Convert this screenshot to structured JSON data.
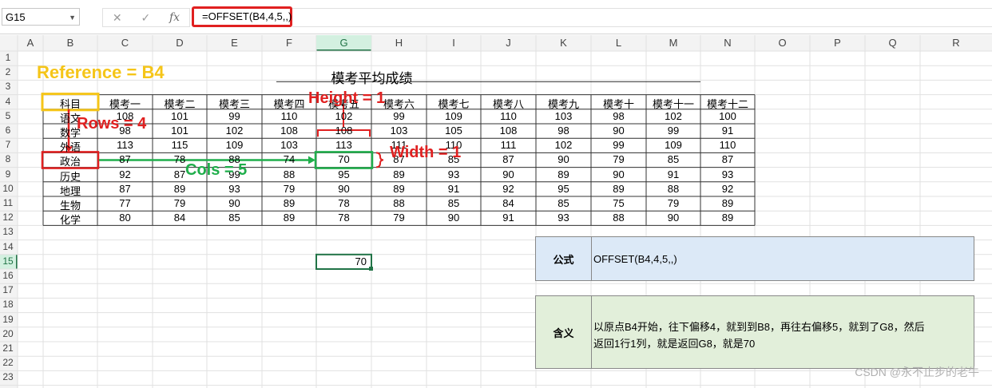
{
  "formula_bar": {
    "name_box": "G15",
    "cancel_symbol": "✕",
    "confirm_symbol": "✓",
    "fx_symbol": "fx",
    "formula": "=OFFSET(B4,4,5,,)"
  },
  "columns": [
    "A",
    "B",
    "C",
    "D",
    "E",
    "F",
    "G",
    "H",
    "I",
    "J",
    "K",
    "L",
    "M",
    "N",
    "O",
    "P",
    "Q",
    "R"
  ],
  "rows": [
    "1",
    "2",
    "3",
    "4",
    "5",
    "6",
    "7",
    "8",
    "9",
    "10",
    "11",
    "12",
    "13",
    "14",
    "15",
    "16",
    "17",
    "18",
    "19",
    "20",
    "21",
    "22",
    "23"
  ],
  "table": {
    "title": "模考平均成绩",
    "header": [
      "科目",
      "模考一",
      "模考二",
      "模考三",
      "模考四",
      "模考五",
      "模考六",
      "模考七",
      "模考八",
      "模考九",
      "模考十",
      "模考十一",
      "模考十二"
    ],
    "rows": [
      [
        "语文",
        "108",
        "101",
        "99",
        "110",
        "102",
        "99",
        "109",
        "110",
        "103",
        "98",
        "102",
        "100"
      ],
      [
        "数学",
        "98",
        "101",
        "102",
        "108",
        "108",
        "103",
        "105",
        "108",
        "98",
        "90",
        "99",
        "91"
      ],
      [
        "外语",
        "113",
        "115",
        "109",
        "103",
        "113",
        "111",
        "110",
        "111",
        "102",
        "99",
        "109",
        "110"
      ],
      [
        "政治",
        "87",
        "78",
        "88",
        "74",
        "70",
        "87",
        "85",
        "87",
        "90",
        "79",
        "85",
        "87"
      ],
      [
        "历史",
        "92",
        "87",
        "99",
        "88",
        "95",
        "89",
        "93",
        "90",
        "89",
        "90",
        "91",
        "93"
      ],
      [
        "地理",
        "87",
        "89",
        "93",
        "79",
        "90",
        "89",
        "91",
        "92",
        "95",
        "89",
        "88",
        "92"
      ],
      [
        "生物",
        "77",
        "79",
        "90",
        "89",
        "78",
        "88",
        "85",
        "84",
        "85",
        "75",
        "79",
        "89"
      ],
      [
        "化学",
        "80",
        "84",
        "85",
        "89",
        "78",
        "79",
        "90",
        "91",
        "93",
        "88",
        "90",
        "89"
      ]
    ]
  },
  "result_cell": "70",
  "annotations": {
    "reference": "Reference = B4",
    "rows": "Rows = 4",
    "cols": "Cols = 5",
    "height": "Height = 1",
    "width": "Width = 1"
  },
  "panel": {
    "formula_label": "公式",
    "formula_value": "OFFSET(B4,4,5,,)",
    "meaning_label": "含义",
    "meaning_line1": "以原点B4开始，往下偏移4，就到到B8，再往右偏移5，就到了G8，然后",
    "meaning_line2": "返回1行1列，就是返回G8，就是70"
  },
  "watermark": "CSDN @永不止步的老牛",
  "colors": {
    "red": "#e02020",
    "green": "#1fae4b",
    "yellow": "#f5c518",
    "selection": "#217346",
    "panel_blue": "#dce9f7",
    "panel_green": "#e2efda"
  }
}
